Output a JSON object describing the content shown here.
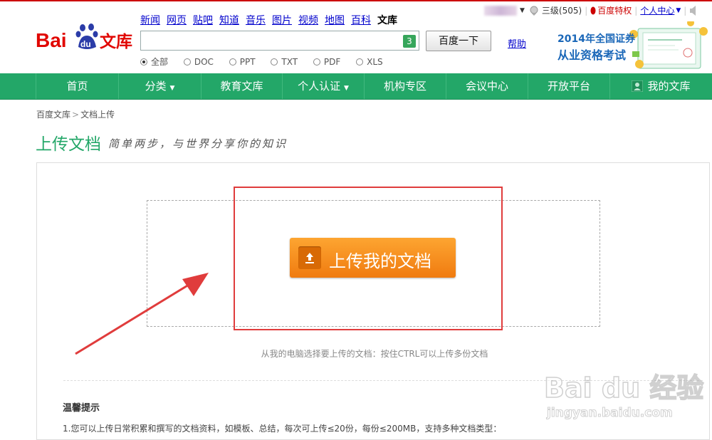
{
  "header": {
    "logo_text": "Bai du 文库",
    "nav": [
      "新闻",
      "网页",
      "贴吧",
      "知道",
      "音乐",
      "图片",
      "视频",
      "地图",
      "百科"
    ],
    "nav_current": "文库",
    "search_badge": "3",
    "search_value": "",
    "search_button": "百度一下",
    "help": "帮助",
    "types": [
      {
        "label": "全部",
        "selected": true
      },
      {
        "label": "DOC",
        "selected": false
      },
      {
        "label": "PPT",
        "selected": false
      },
      {
        "label": "TXT",
        "selected": false
      },
      {
        "label": "PDF",
        "selected": false
      },
      {
        "label": "XLS",
        "selected": false
      }
    ]
  },
  "userbar": {
    "level": "三级(505)",
    "privilege": "百度特权",
    "center": "个人中心"
  },
  "ad": {
    "line1": "2014年全国证券",
    "line2": "从业资格考试"
  },
  "green_nav": [
    "首页",
    "分类",
    "教育文库",
    "个人认证",
    "机构专区",
    "会议中心",
    "开放平台",
    "我的文库"
  ],
  "breadcrumb": [
    "百度文库",
    "文档上传"
  ],
  "page": {
    "title": "上传文档",
    "subtitle": "简单两步，与世界分享你的知识"
  },
  "upload": {
    "button_label": "上传我的文档",
    "hint": "从我的电脑选择要上传的文档：按住CTRL可以上传多份文档"
  },
  "tips": {
    "title": "温馨提示",
    "line1": "1.您可以上传日常积累和撰写的文档资料，如模板、总结，每次可上传≤20份，每份≤200MB，支持多种文档类型："
  },
  "watermark": {
    "main": "Bai du 经验",
    "url": "jingyan.baidu.com"
  },
  "colors": {
    "green": "#23a768",
    "orange": "#f5901f",
    "highlight_red": "#e03c3c",
    "link_blue": "#0000cc"
  }
}
